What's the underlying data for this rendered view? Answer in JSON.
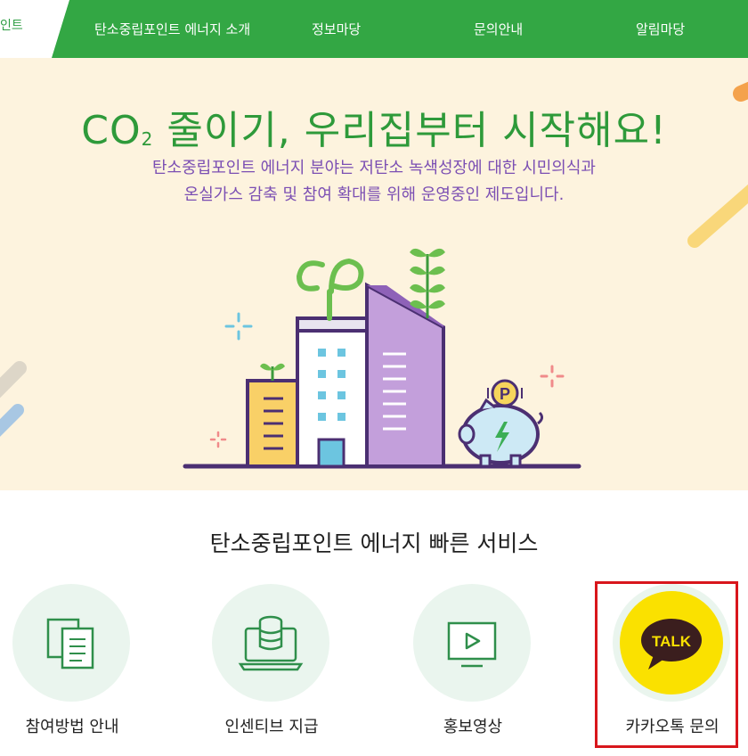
{
  "header": {
    "logo_text": "인트",
    "nav": [
      "탄소중립포인트 에너지 소개",
      "정보마당",
      "문의안내",
      "알림마당"
    ]
  },
  "hero": {
    "title_main": "CO",
    "title_sub": "2",
    "title_rest": " 줄이기, 우리집부터 시작해요!",
    "desc_line1": "탄소중립포인트 에너지 분야는 저탄소 녹색성장에 대한 시민의식과",
    "desc_line2": "온실가스 감축 및 참여 확대를 위해 운영중인 제도입니다.",
    "coin_letter": "P"
  },
  "services": {
    "title": "탄소중립포인트 에너지 빠른 서비스",
    "items": [
      {
        "label": "참여방법 안내",
        "icon": "documents-icon"
      },
      {
        "label": "인센티브 지급",
        "icon": "laptop-coins-icon"
      },
      {
        "label": "홍보영상",
        "icon": "video-play-icon"
      },
      {
        "label": "카카오톡 문의",
        "icon": "kakaotalk-icon",
        "badge": "TALK"
      }
    ]
  },
  "colors": {
    "nav_green": "#33a744",
    "hero_bg": "#fdf3de",
    "title_green": "#2e9a3a",
    "desc_purple": "#7b4fb3",
    "kakao_yellow": "#fae100",
    "highlight_red": "#d8161c"
  }
}
